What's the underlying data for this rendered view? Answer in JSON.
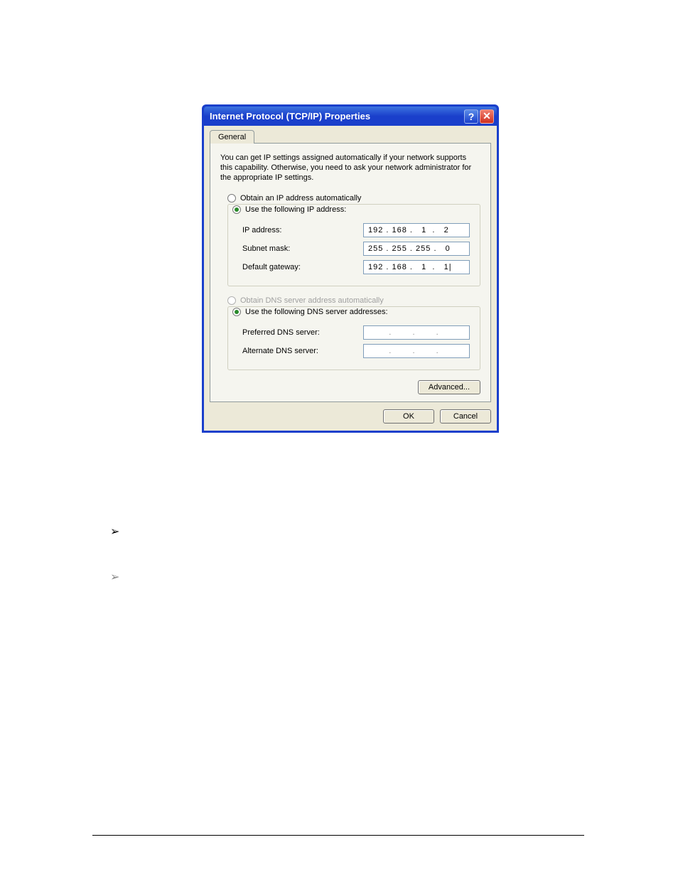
{
  "dialog": {
    "title": "Internet Protocol (TCP/IP) Properties",
    "tab": "General",
    "description": "You can get IP settings assigned automatically if your network supports this capability. Otherwise, you need to ask your network administrator for the appropriate IP settings.",
    "ip_section": {
      "auto_label": "Obtain an IP address automatically",
      "manual_label": "Use the following IP address:",
      "ip_label": "IP address:",
      "ip_value": "192 . 168 .   1  .   2",
      "subnet_label": "Subnet mask:",
      "subnet_value": "255 . 255 . 255 .   0",
      "gateway_label": "Default gateway:",
      "gateway_value": "192 . 168 .   1  .   1|"
    },
    "dns_section": {
      "auto_label": "Obtain DNS server address automatically",
      "manual_label": "Use the following DNS server addresses:",
      "preferred_label": "Preferred DNS server:",
      "preferred_value": ".  .  .",
      "alternate_label": "Alternate DNS server:",
      "alternate_value": ".  .  ."
    },
    "advanced_label": "Advanced...",
    "ok_label": "OK",
    "cancel_label": "Cancel"
  },
  "bullets": {
    "b1": "➢",
    "b2": "➢"
  }
}
